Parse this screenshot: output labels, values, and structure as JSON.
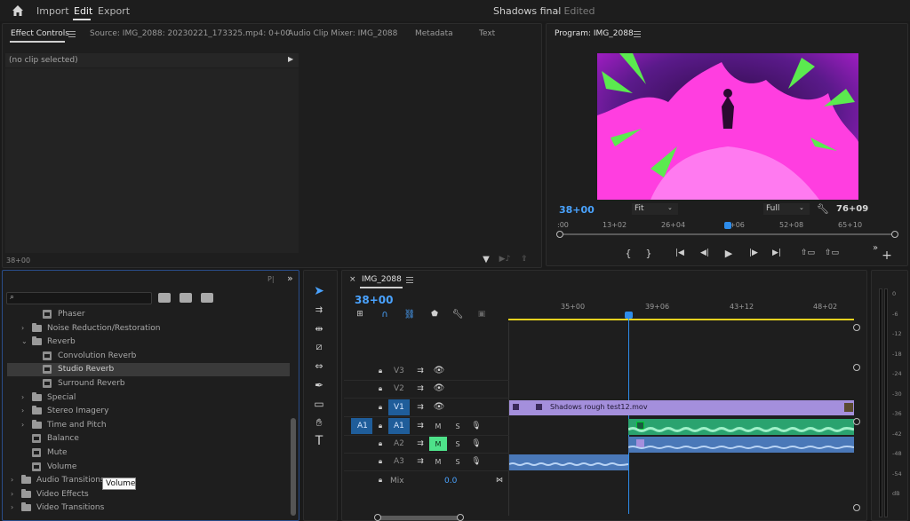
{
  "header": {
    "menu": [
      "Import",
      "Edit",
      "Export"
    ],
    "active": "Edit",
    "project_title": "Shadows final",
    "project_status": "- Edited"
  },
  "source_panel": {
    "tabs": [
      "Effect Controls",
      "Source: IMG_2088: 20230221_173325.mp4: 0+00",
      "Audio Clip Mixer: IMG_2088",
      "Metadata",
      "Text"
    ],
    "active_tab": "Effect Controls",
    "no_clip": "(no clip selected)",
    "timecode": "38+00"
  },
  "program_monitor": {
    "title": "Program: IMG_2088",
    "timecode": "38+00",
    "fit": "Fit",
    "quality": "Full",
    "duration": "76+09",
    "ruler_labels": [
      ":00",
      "13+02",
      "26+04",
      "+06",
      "52+08",
      "65+10"
    ],
    "playhead": 0.5
  },
  "effects_panel": {
    "search_value": "",
    "tree": [
      {
        "label": "Phaser",
        "kind": "effect",
        "indent": 2
      },
      {
        "label": "Noise Reduction/Restoration",
        "kind": "folder",
        "indent": 1,
        "open": false
      },
      {
        "label": "Reverb",
        "kind": "folder",
        "indent": 1,
        "open": true
      },
      {
        "label": "Convolution Reverb",
        "kind": "effect",
        "indent": 2
      },
      {
        "label": "Studio Reverb",
        "kind": "effect",
        "indent": 2,
        "selected": true
      },
      {
        "label": "Surround Reverb",
        "kind": "effect",
        "indent": 2
      },
      {
        "label": "Special",
        "kind": "folder",
        "indent": 1,
        "open": false
      },
      {
        "label": "Stereo Imagery",
        "kind": "folder",
        "indent": 1,
        "open": false
      },
      {
        "label": "Time and Pitch",
        "kind": "folder",
        "indent": 1,
        "open": false
      },
      {
        "label": "Balance",
        "kind": "effect",
        "indent": 1
      },
      {
        "label": "Mute",
        "kind": "effect",
        "indent": 1
      },
      {
        "label": "Volume",
        "kind": "effect",
        "indent": 1
      },
      {
        "label": "Audio Transitions",
        "kind": "folder",
        "indent": 0,
        "open": false
      },
      {
        "label": "Video Effects",
        "kind": "folder",
        "indent": 0,
        "open": false
      },
      {
        "label": "Video Transitions",
        "kind": "folder",
        "indent": 0,
        "open": false
      }
    ],
    "tooltip": "Volume"
  },
  "timeline": {
    "sequence_name": "IMG_2088",
    "timecode": "38+00",
    "ruler_labels": [
      "35+00",
      "39+06",
      "43+12",
      "48+02"
    ],
    "tracks": [
      {
        "name": "V3",
        "type": "video",
        "highlight": false
      },
      {
        "name": "V2",
        "type": "video",
        "highlight": false
      },
      {
        "name": "V1",
        "type": "video",
        "highlight": true
      },
      {
        "name": "A1",
        "type": "audio",
        "highlight": true,
        "mute_on": false
      },
      {
        "name": "A2",
        "type": "audio",
        "highlight": false,
        "mute_on": true
      },
      {
        "name": "A3",
        "type": "audio",
        "highlight": false,
        "mute_on": false
      }
    ],
    "source_patch": "A1",
    "track_buttons": {
      "mute": "M",
      "solo": "S"
    },
    "mix_label": "Mix",
    "mix_value": "0.0",
    "clip_name": "Shadows rough test12.mov"
  },
  "audio_meter": {
    "ticks": [
      "0",
      "-6",
      "-12",
      "-18",
      "-24",
      "-30",
      "-36",
      "-42",
      "-48",
      "-54",
      "dB"
    ]
  },
  "colors": {
    "accent_blue": "#2d8ceb",
    "video_clip": "#a48fdc",
    "audio_clip_green": "#2aa36f",
    "audio_clip_blue": "#4a78b8",
    "mute_green": "#4ee28a",
    "playhead_line": "#2d8ceb"
  }
}
